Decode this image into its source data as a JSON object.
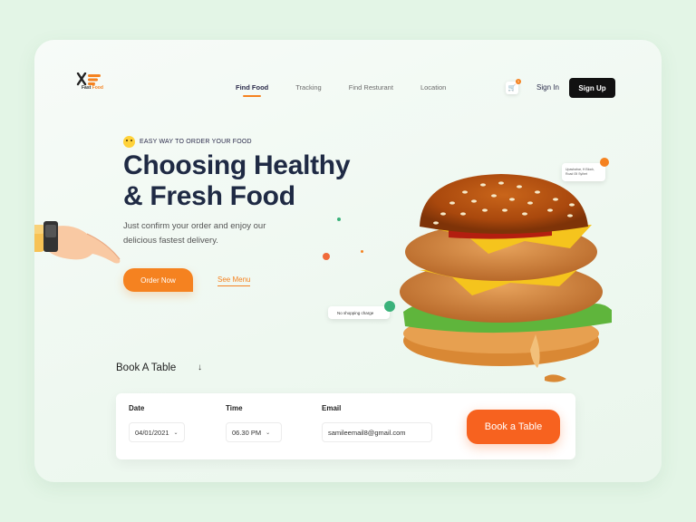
{
  "brand": {
    "name_part1": "Fast",
    "name_part2": "Food"
  },
  "nav": {
    "items": [
      "Find Food",
      "Tracking",
      "Find Resturant",
      "Location"
    ]
  },
  "header": {
    "cart_count": "1",
    "signin": "Sign In",
    "signup": "Sign Up"
  },
  "hero": {
    "eyebrow": "EASY WAY TO  ORDER YOUR FOOD",
    "headline_line1": "Choosing Healthy",
    "headline_line2": "& Fresh Food",
    "subtext": "Just confirm your order and enjoy our delicious fastest delivery.",
    "order_btn": "Order Now",
    "see_menu": "See Menu"
  },
  "tags": {
    "address": "Upashahar, H Block, Road 05 Sylhet",
    "shipping": "No  shopping charge"
  },
  "booking": {
    "title": "Book A Table",
    "arrow": "↓",
    "date_label": "Date",
    "date_value": "04/01/2021",
    "time_label": "Time",
    "time_value": "06.30 PM",
    "email_label": "Email",
    "email_value": "samileemail8@gmail.com",
    "submit": "Book a Table"
  },
  "colors": {
    "accent": "#f58220",
    "dark": "#1f2a44",
    "green": "#3ab27a"
  }
}
